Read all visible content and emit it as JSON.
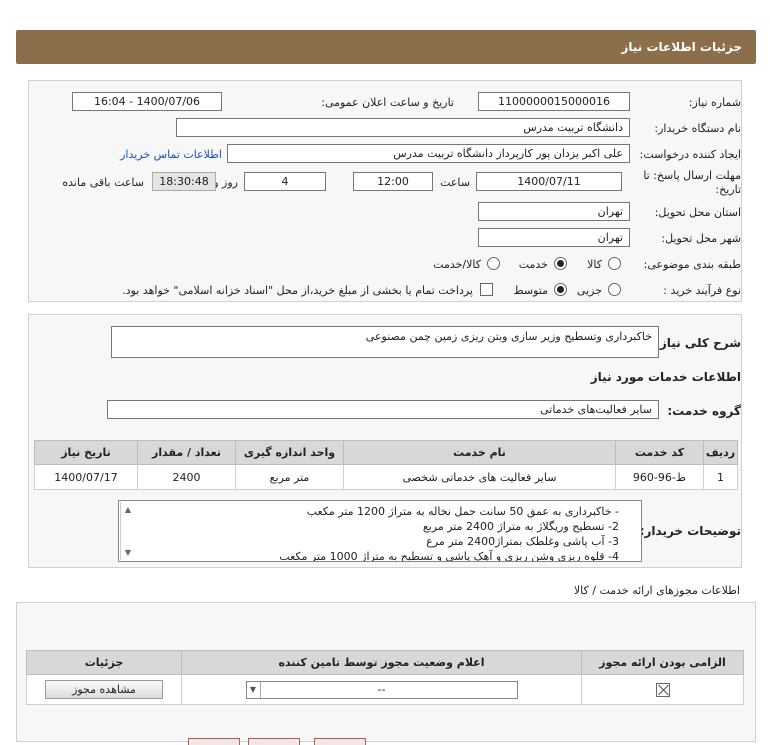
{
  "header": {
    "title": "جزئیات اطلاعات نیاز"
  },
  "form": {
    "need_number_label": "شماره نیاز:",
    "need_number": "1100000015000016",
    "announce_label": "تاریخ و ساعت اعلان عمومی:",
    "announce_value": "1400/07/06 - 16:04",
    "buyer_org_label": "نام دستگاه خریدار:",
    "buyer_org": "دانشگاه تربیت مدرس",
    "requester_label": "ایجاد کننده درخواست:",
    "requester": "علی اکبر یزدان پور کارپرداز دانشگاه تربیت مدرس",
    "contact_link": "اطلاعات تماس خریدار",
    "deadline_label_1": "مهلت ارسال پاسخ: تا",
    "deadline_label_2": "تاریخ:",
    "deadline_date": "1400/07/11",
    "time_label": "ساعت",
    "deadline_time": "12:00",
    "days_value": "4",
    "days_label": "روز و",
    "remaining_time": "18:30:48",
    "remaining_label": "ساعت باقی مانده",
    "province_label": "استان محل تحویل:",
    "province": "تهران",
    "city_label": "شهر محل تحویل:",
    "city": "تهران",
    "category_label": "طبقه بندی موضوعی:",
    "category_options": [
      "کالا",
      "خدمت",
      "کالا/خدمت"
    ],
    "process_label": "نوع فرآیند خرید :",
    "process_options": [
      "جزیی",
      "متوسط"
    ],
    "payment_note": "پرداخت تمام یا بخشی از مبلغ خرید،از محل \"اسناد خزانه اسلامی\" خواهد بود."
  },
  "summary": {
    "label": "شرح کلی نیاز:",
    "value": "خاکبرداری وتسطیح وزیر سازی وبتن ریزی زمین چمن مصنوعی"
  },
  "services": {
    "section_title": "اطلاعات خدمات مورد نیاز",
    "group_label": "گروه خدمت:",
    "group_value": "سایر فعالیت‌های خدماتی",
    "columns": [
      "ردیف",
      "کد خدمت",
      "نام خدمت",
      "واحد اندازه گیری",
      "تعداد / مقدار",
      "تاریخ نیاز"
    ],
    "rows": [
      [
        "1",
        "ط-96-960",
        "سایر فعالیت های خدماتی شخصی",
        "متر مربع",
        "2400",
        "1400/07/17"
      ]
    ]
  },
  "buyer_notes": {
    "label": "توضیحات خریدار:",
    "lines": [
      "- خاکبرداری به عمق 50 سانت حمل نخاله به متراژ 1200 متر مکعب",
      "2- تسطیح وریگلاژ به متراژ 2400 متر مربع",
      "3- آب پاشی وغلطک بمتراژ2400 متر مرع",
      "4- قلوه ریزی وشن ریزی و آهک پاشی و تسطیح به متراژ 1000 متر مکعب"
    ]
  },
  "permits": {
    "title": "اطلاعات مجوزهای ارائه خدمت / کالا",
    "columns": [
      "الزامی بودن ارائه مجوز",
      "اعلام وضعیت مجوز توسط تامین کننده",
      "جزئیات"
    ],
    "status_value": "--",
    "view_button": "مشاهده مجوز"
  },
  "colors": {
    "header": "#8b6f4a",
    "link": "#1a50c8"
  }
}
